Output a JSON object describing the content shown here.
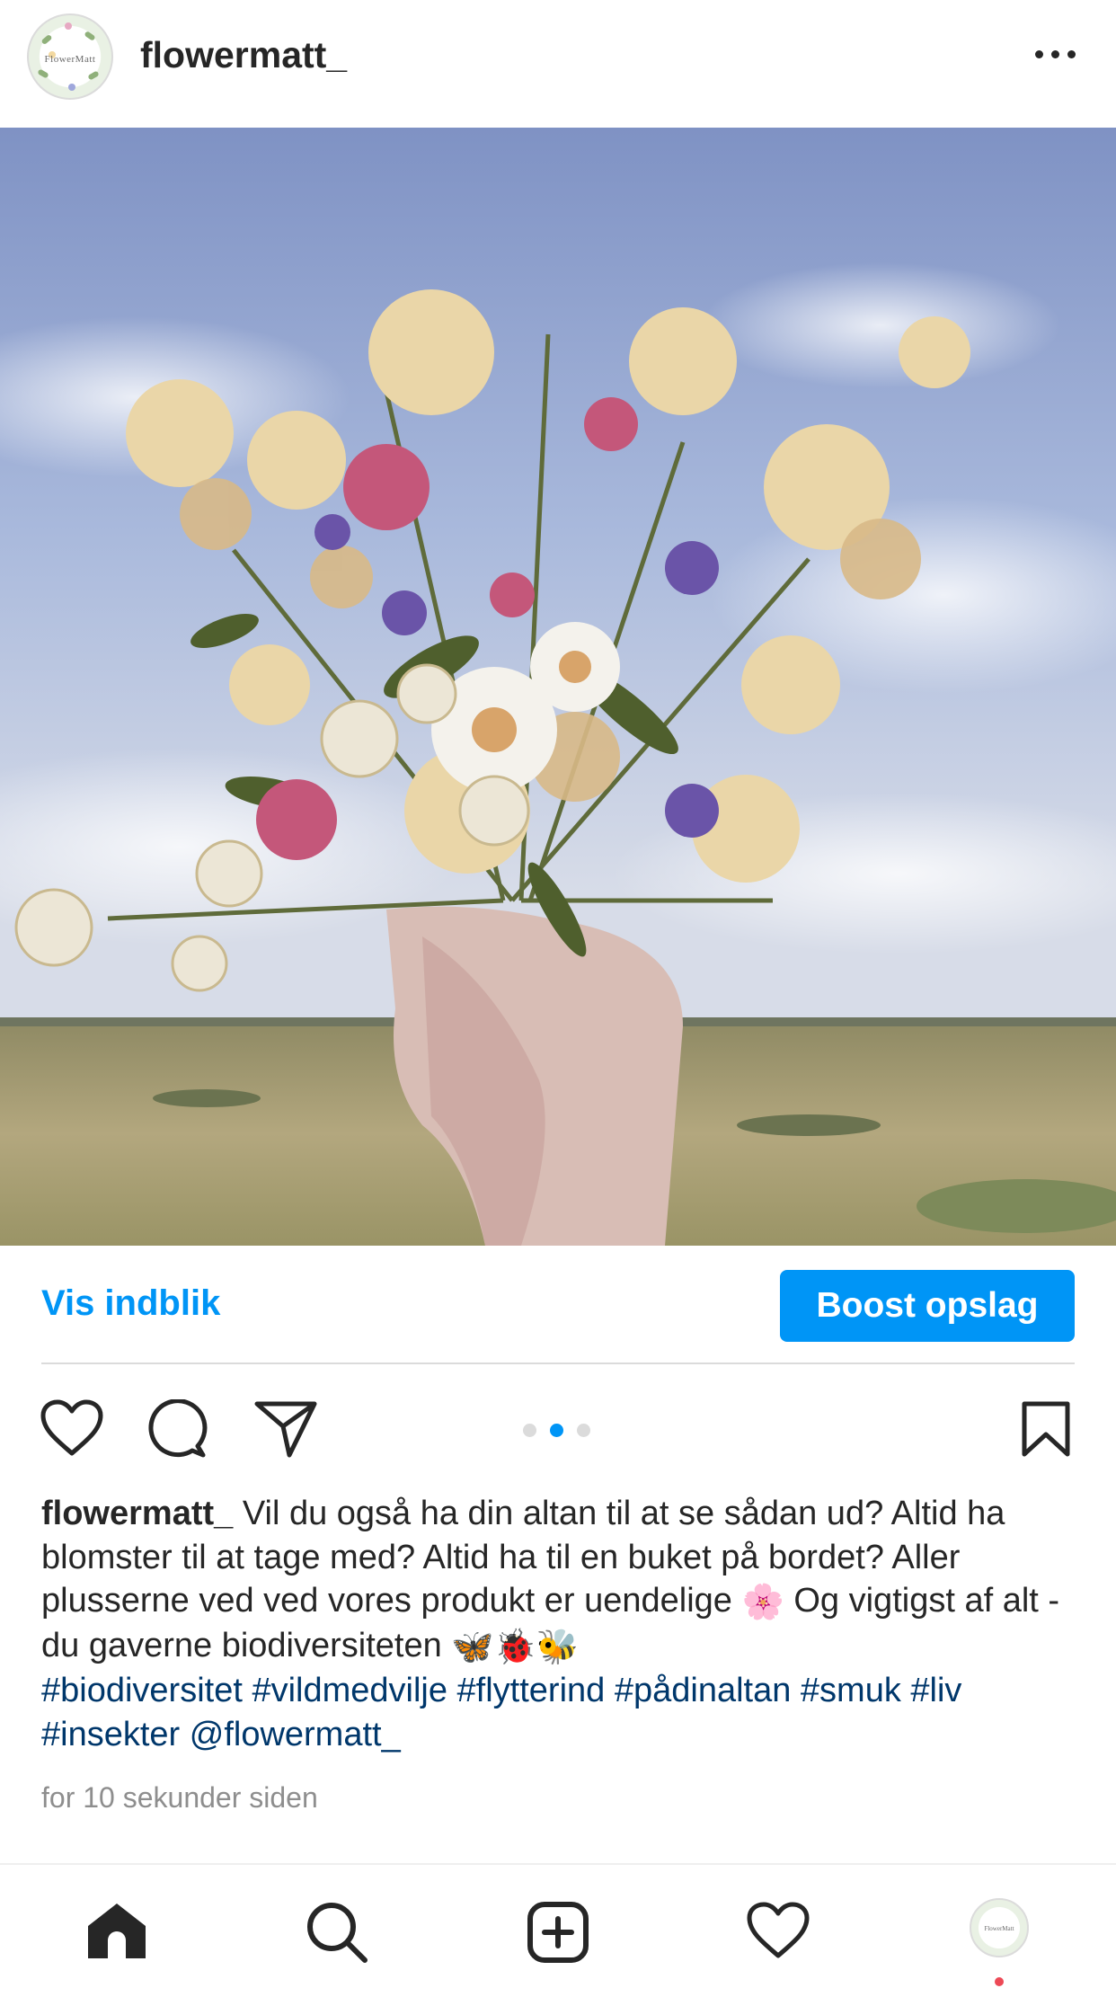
{
  "post": {
    "username": "flowermatt_",
    "avatar_logo_text": "FlowerMatt",
    "photo_alt": "Bouquet of wildflowers held up against a blue sky over a meadow"
  },
  "actions": {
    "insights_label": "Vis indblik",
    "boost_label": "Boost opslag",
    "carousel_active_index": 1,
    "carousel_count": 3
  },
  "caption": {
    "username": "flowermatt_",
    "text": " Vil du også ha din altan til at se sådan ud? Altid ha blomster til at tage med? Altid ha til en buket på bordet? Aller plusserne ved ved vores produkt er uendelige ",
    "emoji_flower": "🌸",
    "text2": " Og vigtigst af alt - du gaverne biodiversiteten ",
    "emoji_end": "🦋🐞🐝",
    "hashtags": "#biodiversitet #vildmedvilje #flytterind #pådinaltan #smuk #liv #insekter @flowermatt_"
  },
  "timestamp": "for 10 sekunder siden",
  "colors": {
    "accent": "#0095f6",
    "hashtag": "#00376b",
    "text": "#262626",
    "muted": "#8e8e8e",
    "notification": "#ed4956"
  },
  "tabbar": {
    "items": [
      "home-icon",
      "search-icon",
      "create-icon",
      "activity-heart-icon",
      "profile-avatar"
    ]
  }
}
